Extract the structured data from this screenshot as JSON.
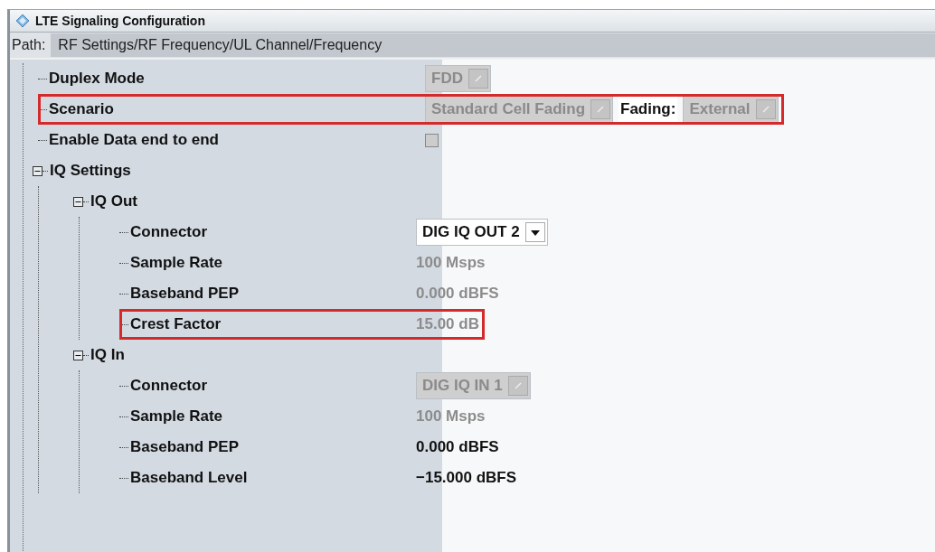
{
  "window": {
    "title": "LTE Signaling Configuration"
  },
  "path": {
    "label": "Path:",
    "value": "RF Settings/RF Frequency/UL Channel/Frequency"
  },
  "tree": [
    {
      "label": "Duplex Mode",
      "highlighted": false,
      "value": [
        {
          "kind": "dropdown",
          "text": "FDD",
          "disabled": true
        }
      ]
    },
    {
      "label": "Scenario",
      "highlighted": true,
      "value": [
        {
          "kind": "dropdown",
          "text": "Standard Cell Fading",
          "disabled": true
        },
        {
          "kind": "label",
          "text": "Fading:"
        },
        {
          "kind": "dropdown",
          "text": "External",
          "disabled": true
        }
      ]
    },
    {
      "label": "Enable Data end to end",
      "highlighted": false,
      "value": [
        {
          "kind": "checkbox",
          "checked": false,
          "disabled": true
        }
      ]
    },
    {
      "label": "IQ Settings",
      "expanded": true,
      "highlighted": false,
      "children": [
        {
          "label": "IQ Out",
          "expanded": true,
          "highlighted": false,
          "children": [
            {
              "label": "Connector",
              "highlighted": false,
              "value": [
                {
                  "kind": "dropdown",
                  "text": "DIG IQ OUT 2",
                  "disabled": false
                }
              ]
            },
            {
              "label": "Sample Rate",
              "highlighted": false,
              "value": [
                {
                  "kind": "text",
                  "text": "100 Msps",
                  "disabled": true
                }
              ]
            },
            {
              "label": "Baseband PEP",
              "highlighted": false,
              "value": [
                {
                  "kind": "text",
                  "text": "0.000 dBFS",
                  "disabled": true
                }
              ]
            },
            {
              "label": "Crest Factor",
              "highlighted": true,
              "value": [
                {
                  "kind": "text",
                  "text": "15.00 dB",
                  "disabled": true
                }
              ]
            }
          ]
        },
        {
          "label": "IQ In",
          "expanded": true,
          "highlighted": false,
          "children": [
            {
              "label": "Connector",
              "highlighted": false,
              "value": [
                {
                  "kind": "dropdown",
                  "text": "DIG IQ IN 1",
                  "disabled": true
                }
              ]
            },
            {
              "label": "Sample Rate",
              "highlighted": false,
              "value": [
                {
                  "kind": "text",
                  "text": "100 Msps",
                  "disabled": true
                }
              ]
            },
            {
              "label": "Baseband PEP",
              "highlighted": false,
              "value": [
                {
                  "kind": "text",
                  "text": "0.000 dBFS",
                  "disabled": false
                }
              ]
            },
            {
              "label": "Baseband Level",
              "highlighted": false,
              "value": [
                {
                  "kind": "text",
                  "text": "−15.000 dBFS",
                  "disabled": false
                }
              ]
            }
          ]
        }
      ]
    }
  ]
}
